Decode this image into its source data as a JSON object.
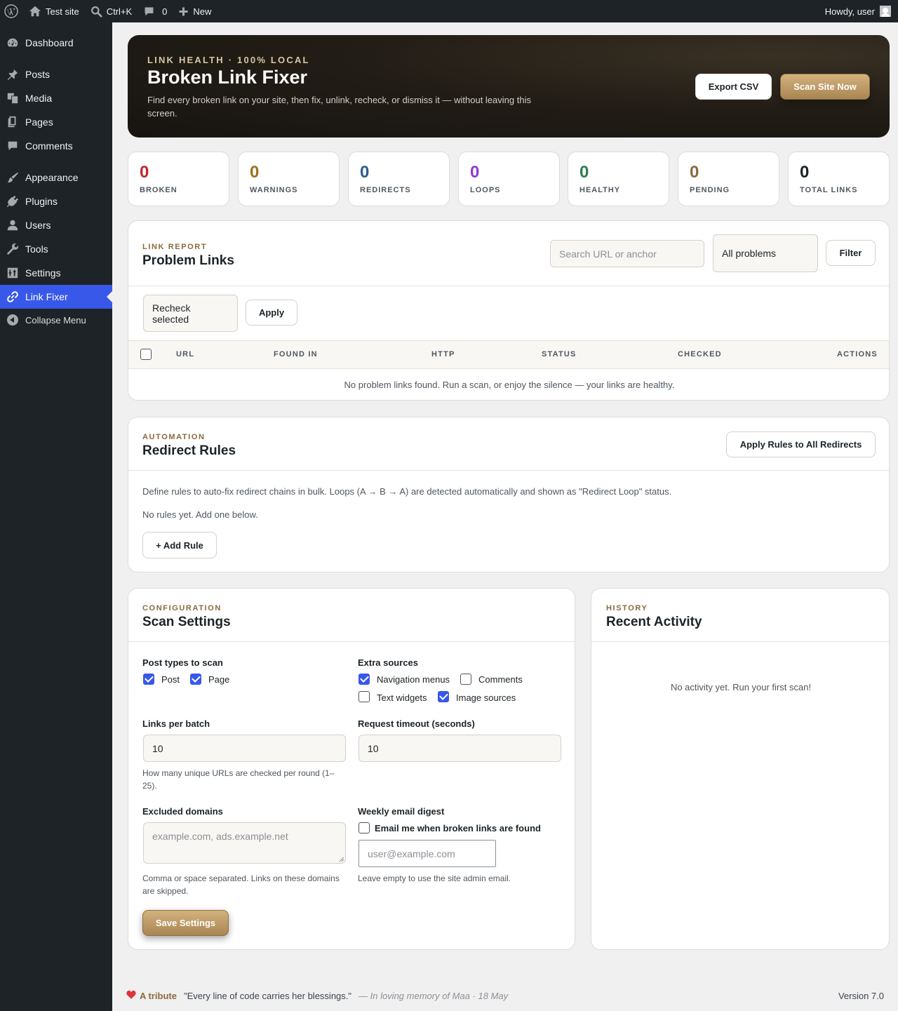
{
  "adminbar": {
    "site_name": "Test site",
    "search_shortcut": "Ctrl+K",
    "comments_count": "0",
    "new_label": "New",
    "howdy": "Howdy, user"
  },
  "sidebar": {
    "items": [
      {
        "label": "Dashboard",
        "icon": "dashboard-icon"
      },
      {
        "label": "Posts",
        "icon": "pin-icon"
      },
      {
        "label": "Media",
        "icon": "media-icon"
      },
      {
        "label": "Pages",
        "icon": "pages-icon"
      },
      {
        "label": "Comments",
        "icon": "comment-icon"
      },
      {
        "label": "Appearance",
        "icon": "brush-icon"
      },
      {
        "label": "Plugins",
        "icon": "plugin-icon"
      },
      {
        "label": "Users",
        "icon": "user-icon"
      },
      {
        "label": "Tools",
        "icon": "wrench-icon"
      },
      {
        "label": "Settings",
        "icon": "settings-icon"
      },
      {
        "label": "Link Fixer",
        "icon": "link-icon"
      }
    ],
    "collapse_label": "Collapse Menu"
  },
  "hero": {
    "eyebrow": "Link Health · 100% Local",
    "title": "Broken Link Fixer",
    "description": "Find every broken link on your site, then fix, unlink, recheck, or dismiss it — without leaving this screen.",
    "export_label": "Export CSV",
    "scan_label": "Scan Site Now"
  },
  "stats": [
    {
      "value": "0",
      "label": "Broken",
      "color": "#c0262d"
    },
    {
      "value": "0",
      "label": "Warnings",
      "color": "#a0701d"
    },
    {
      "value": "0",
      "label": "Redirects",
      "color": "#2e5d8f"
    },
    {
      "value": "0",
      "label": "Loops",
      "color": "#8e3ad6"
    },
    {
      "value": "0",
      "label": "Healthy",
      "color": "#2e7d4f"
    },
    {
      "value": "0",
      "label": "Pending",
      "color": "#8a6a3c"
    },
    {
      "value": "0",
      "label": "Total Links",
      "color": "#1d2327"
    }
  ],
  "report": {
    "eyebrow": "Link Report",
    "title": "Problem Links",
    "search_placeholder": "Search URL or anchor",
    "filter_select": "All problems",
    "filter_label": "Filter",
    "bulk_select": "Recheck selected",
    "apply_label": "Apply",
    "columns": [
      "URL",
      "Found In",
      "HTTP",
      "Status",
      "Checked",
      "Actions"
    ],
    "empty": "No problem links found. Run a scan, or enjoy the silence — your links are healthy."
  },
  "rules": {
    "eyebrow": "Automation",
    "title": "Redirect Rules",
    "apply_all_label": "Apply Rules to All Redirects",
    "description": "Define rules to auto-fix redirect chains in bulk. Loops (A → B → A) are detected automatically and shown as \"Redirect Loop\" status.",
    "empty": "No rules yet. Add one below.",
    "add_label": "+ Add Rule"
  },
  "settings": {
    "eyebrow": "Configuration",
    "title": "Scan Settings",
    "post_types_label": "Post types to scan",
    "post_types": [
      {
        "label": "Post",
        "checked": true
      },
      {
        "label": "Page",
        "checked": true
      }
    ],
    "extra_label": "Extra sources",
    "extra_sources": [
      {
        "label": "Navigation menus",
        "checked": true
      },
      {
        "label": "Comments",
        "checked": false
      },
      {
        "label": "Text widgets",
        "checked": false
      },
      {
        "label": "Image sources",
        "checked": true
      }
    ],
    "batch_label": "Links per batch",
    "batch_value": "10",
    "batch_help": "How many unique URLs are checked per round (1–25).",
    "timeout_label": "Request timeout (seconds)",
    "timeout_value": "10",
    "excluded_label": "Excluded domains",
    "excluded_placeholder": "example.com, ads.example.net",
    "excluded_help": "Comma or space separated. Links on these domains are skipped.",
    "digest_label": "Weekly email digest",
    "digest_checkbox": "Email me when broken links are found",
    "email_placeholder": "user@example.com",
    "email_help": "Leave empty to use the site admin email.",
    "save_label": "Save Settings"
  },
  "history": {
    "eyebrow": "History",
    "title": "Recent Activity",
    "empty": "No activity yet. Run your first scan!"
  },
  "footer": {
    "tribute": "A tribute",
    "quote": "\"Every line of code carries her blessings.\"",
    "memory": "— In loving memory of Maa · 18 May",
    "version": "Version 7.0"
  }
}
